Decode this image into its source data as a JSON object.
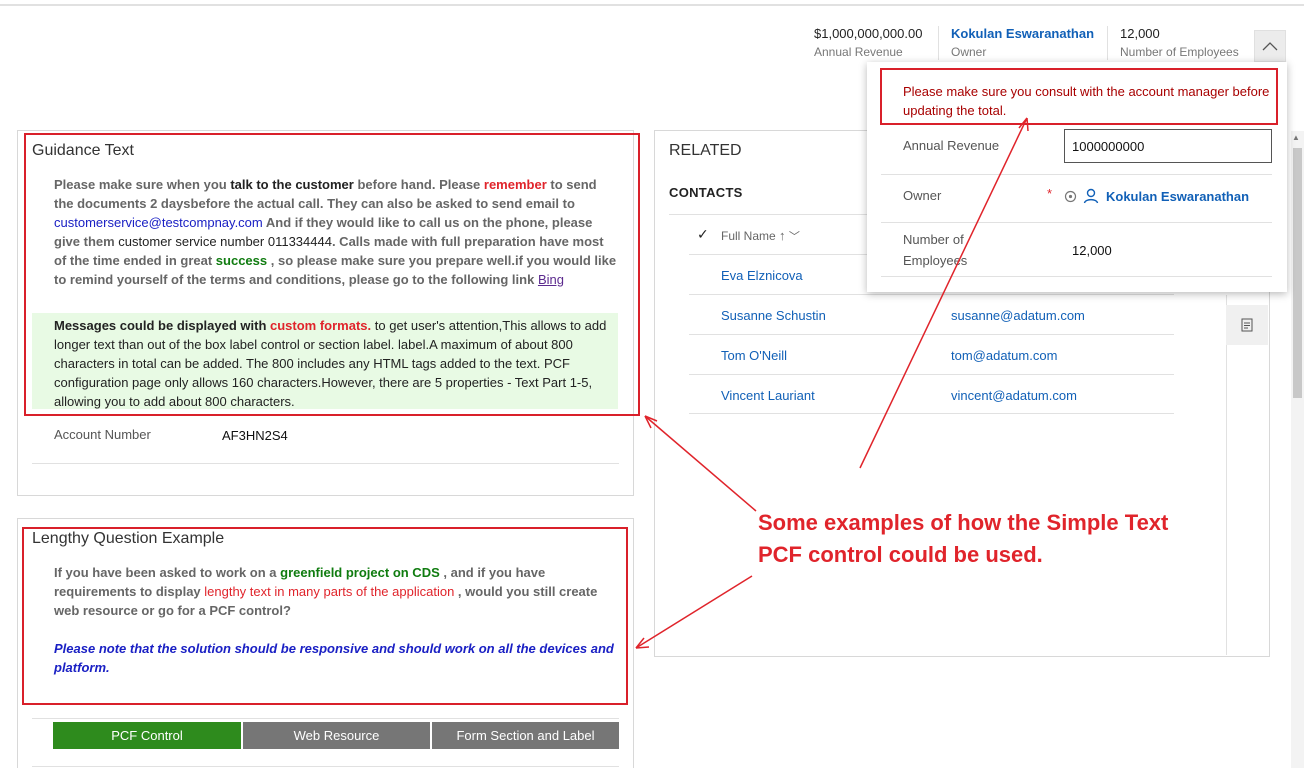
{
  "header": {
    "annual_revenue_value": "$1,000,000,000.00",
    "annual_revenue_label": "Annual Revenue",
    "owner_value": "Kokulan Eswaranathan",
    "owner_label": "Owner",
    "employees_value": "12,000",
    "employees_label": "Number of Employees",
    "collapse_icon": "chevron-up-icon"
  },
  "guidance": {
    "title": "Guidance Text",
    "p1": "Please make sure when you ",
    "p1_bold": "talk to the customer",
    "p2": " before hand. Please ",
    "p2_red": "remember",
    "p3": " to send the documents 2 daysbefore the actual call. They can also be asked to send email to ",
    "email": "customerservice@testcompnay.com",
    "p4": " And if they would like to call us on the phone, please give them ",
    "p4_dark": "customer service number 011334444",
    "p5": ". Calls made with full preparation have most of the time ended in great ",
    "p5_green": "success",
    "p6": " , so please make sure you prepare well.if you would like to remind yourself of the terms and conditions, please go to the following link ",
    "link": "Bing",
    "msg1": "Messages could be displayed with ",
    "msg1_red": "custom formats.",
    "msg2": " to get user's attention,This allows to add longer text than out of the box label control or section label. label.A maximum of about 800 characters in total can be added. The 800 includes any HTML tags added to the text. PCF configuration page only allows 160 characters.However, there are 5 properties - Text Part 1-5, allowing you to add about 800 characters.",
    "account_label": "Account Number",
    "account_value": "AF3HN2S4"
  },
  "lengthy": {
    "title": "Lengthy Question Example",
    "q1": "If you have been asked to work on a ",
    "q1_green": "greenfield project on CDS",
    "q2": " , and if you have requirements to display ",
    "q2_red": "lengthy text in many parts of the application",
    "q3": " , would you still create web resource or go for a PCF control?",
    "note": "Please note that the solution should be responsive and should work on all the devices and platform.",
    "options": [
      "PCF Control",
      "Web Resource",
      "Form Section and Label"
    ],
    "selected_color": "#2e8b1d",
    "unselected_color": "#767676"
  },
  "related": {
    "title": "RELATED",
    "contacts_title": "CONTACTS",
    "column_full_name": "Full Name",
    "rows": [
      {
        "name": "Eva Elznicova",
        "email": ""
      },
      {
        "name": "Susanne Schustin",
        "email": "susanne@adatum.com"
      },
      {
        "name": "Tom O'Neill",
        "email": "tom@adatum.com"
      },
      {
        "name": "Vincent Lauriant",
        "email": "vincent@adatum.com"
      }
    ]
  },
  "flyout": {
    "message": "Please make sure you consult with the account manager before updating the total.",
    "annual_revenue_label": "Annual Revenue",
    "annual_revenue_input": "1000000000",
    "owner_label": "Owner",
    "owner_value": "Kokulan Eswaranathan",
    "employees_label": "Number of Employees",
    "employees_value": "12,000"
  },
  "annotation": {
    "text": "Some examples of how the Simple Text PCF control could be used.",
    "color": "#e0242b"
  }
}
